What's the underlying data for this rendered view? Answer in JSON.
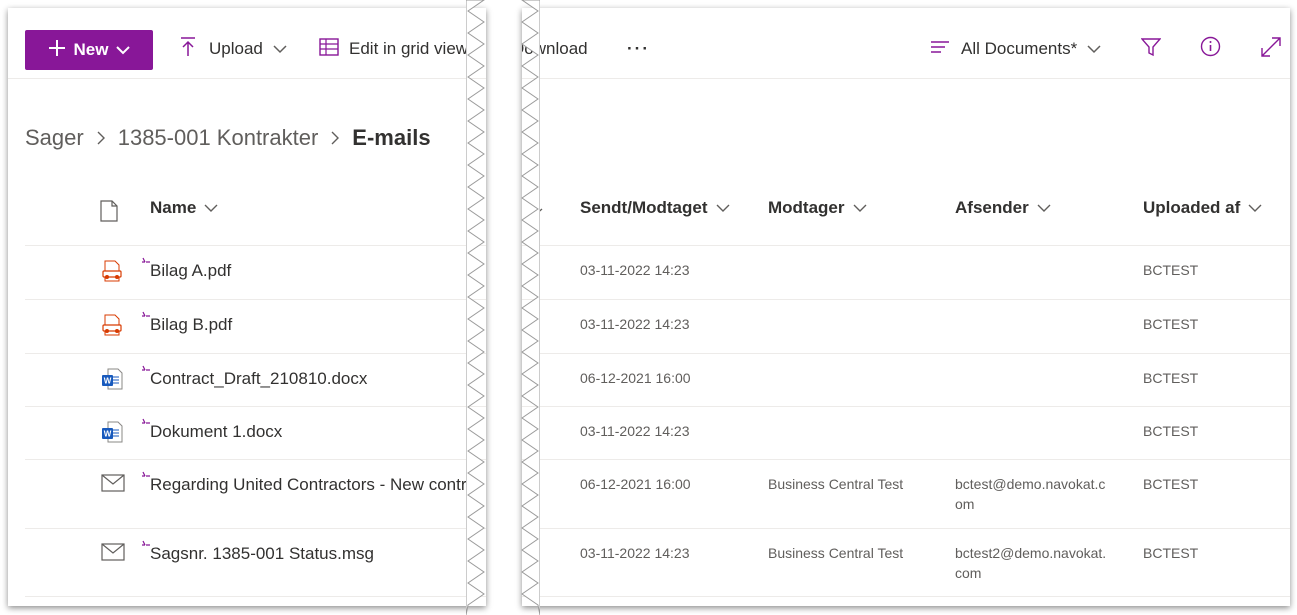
{
  "commandbar": {
    "new_label": "New",
    "upload_label": "Upload",
    "edit_grid_label": "Edit in grid view",
    "download_label": "Download",
    "more_label": "···",
    "view_label": "All Documents*"
  },
  "breadcrumb": [
    "Sager",
    "1385-001 Kontrakter",
    "E-mails"
  ],
  "columns": {
    "name": "Name",
    "sent_received": "Sendt/Modtaget",
    "recipient": "Modtager",
    "sender": "Afsender",
    "uploaded_by": "Uploaded af"
  },
  "rows": [
    {
      "name": "Bilag A.pdf",
      "icon": "pdf-file-icon",
      "sent_received": "03-11-2022 14:23",
      "recipient": "",
      "sender_line1": "",
      "sender_line2": "",
      "uploaded_by": "BCTEST"
    },
    {
      "name": "Bilag B.pdf",
      "icon": "pdf-file-icon",
      "sent_received": "03-11-2022 14:23",
      "recipient": "",
      "sender_line1": "",
      "sender_line2": "",
      "uploaded_by": "BCTEST"
    },
    {
      "name": "Contract_Draft_210810.docx",
      "icon": "word-file-icon",
      "sent_received": "06-12-2021 16:00",
      "recipient": "",
      "sender_line1": "",
      "sender_line2": "",
      "uploaded_by": "BCTEST"
    },
    {
      "name": "Dokument 1.docx",
      "icon": "word-file-icon",
      "sent_received": "03-11-2022 14:23",
      "recipient": "",
      "sender_line1": "",
      "sender_line2": "",
      "uploaded_by": "BCTEST"
    },
    {
      "name": "Regarding United Contractors - New contra",
      "icon": "email-file-icon",
      "sent_received": "06-12-2021 16:00",
      "recipient": "Business Central Test",
      "sender_line1": "bctest@demo.navokat.c",
      "sender_line2": "om",
      "uploaded_by": "BCTEST"
    },
    {
      "name": "Sagsnr. 1385-001 Status.msg",
      "icon": "email-file-icon",
      "sent_received": "03-11-2022 14:23",
      "recipient": "Business Central Test",
      "sender_line1": "bctest2@demo.navokat.",
      "sender_line2": "com",
      "uploaded_by": "BCTEST"
    }
  ],
  "colors": {
    "brand": "#881798",
    "pdf": "#d83b01",
    "word": "#185abd",
    "text": "#323130",
    "subtle": "#605e5c"
  }
}
